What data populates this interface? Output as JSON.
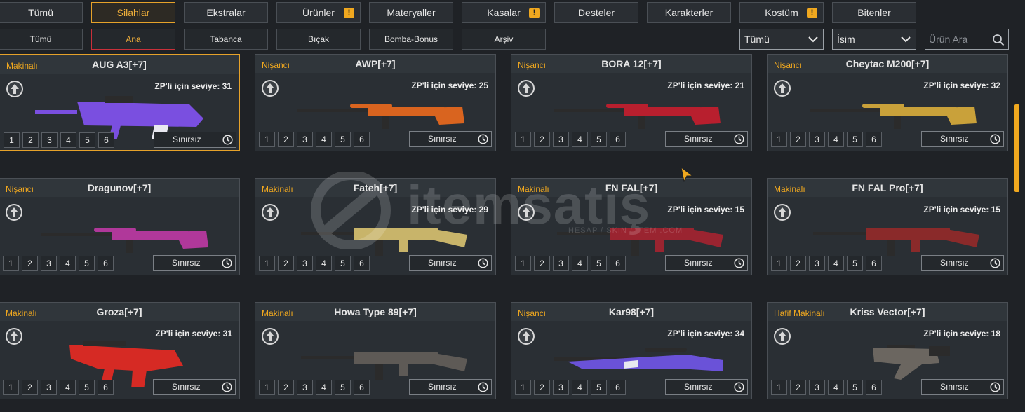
{
  "tabs": [
    {
      "label": "Tümü"
    },
    {
      "label": "Silahlar"
    },
    {
      "label": "Ekstralar"
    },
    {
      "label": "Ürünler",
      "warn": "!"
    },
    {
      "label": "Materyaller"
    },
    {
      "label": "Kasalar",
      "warn": "!"
    },
    {
      "label": "Desteler"
    },
    {
      "label": "Karakterler"
    },
    {
      "label": "Kostüm",
      "warn": "!"
    },
    {
      "label": "Bitenler"
    }
  ],
  "active_tab": "Silahlar",
  "subtabs": [
    {
      "label": "Tümü"
    },
    {
      "label": "Ana"
    },
    {
      "label": "Tabanca"
    },
    {
      "label": "Bıçak"
    },
    {
      "label": "Bomba-Bonus"
    },
    {
      "label": "Arşiv"
    }
  ],
  "active_subtab": "Ana",
  "filters": {
    "type_select": "Tümü",
    "sort_select": "İsim",
    "search_placeholder": "Ürün Ara"
  },
  "slot_numbers": [
    "1",
    "2",
    "3",
    "4",
    "5",
    "6"
  ],
  "duration_label": "Sınırsız",
  "watermark": {
    "text": "itemsatış",
    "sub": "HESAP / SKIN / ITEM .COM"
  },
  "colors": {
    "accent": "#f0a81f",
    "selected_border": "#e6a22a",
    "active_sub_border": "#c9303a"
  },
  "cards": [
    {
      "class": "Makinalı",
      "name": "AUG A3[+7]",
      "level": "ZP'li için seviye: 31",
      "gun_color": "#7a4fe0",
      "gun_shape": "aug",
      "selected": true
    },
    {
      "class": "Nişancı",
      "name": "AWP[+7]",
      "level": "ZP'li için seviye: 25",
      "gun_color": "#d9641f",
      "gun_shape": "sniper",
      "selected": false
    },
    {
      "class": "Nişancı",
      "name": "BORA 12[+7]",
      "level": "ZP'li için seviye: 21",
      "gun_color": "#b81f2e",
      "gun_shape": "sniper",
      "selected": false
    },
    {
      "class": "Nişancı",
      "name": "Cheytac M200[+7]",
      "level": "ZP'li için seviye: 32",
      "gun_color": "#c9a13a",
      "gun_shape": "sniper",
      "selected": false
    },
    {
      "class": "Nişancı",
      "name": "Dragunov[+7]",
      "level": "",
      "gun_color": "#b0389a",
      "gun_shape": "sniper",
      "selected": false
    },
    {
      "class": "Makinalı",
      "name": "Fateh[+7]",
      "level": "ZP'li için seviye: 29",
      "gun_color": "#c8b46a",
      "gun_shape": "rifle",
      "selected": false
    },
    {
      "class": "Makinalı",
      "name": "FN FAL[+7]",
      "level": "ZP'li için seviye: 15",
      "gun_color": "#9a2430",
      "gun_shape": "rifle",
      "selected": false
    },
    {
      "class": "Makinalı",
      "name": "FN FAL Pro[+7]",
      "level": "ZP'li için seviye: 15",
      "gun_color": "#8a2a2a",
      "gun_shape": "rifle",
      "selected": false
    },
    {
      "class": "Makinalı",
      "name": "Groza[+7]",
      "level": "ZP'li için seviye: 31",
      "gun_color": "#d62a24",
      "gun_shape": "groza",
      "selected": false
    },
    {
      "class": "Makinalı",
      "name": "Howa Type 89[+7]",
      "level": "",
      "gun_color": "#5e5a56",
      "gun_shape": "rifle",
      "selected": false
    },
    {
      "class": "Nişancı",
      "name": "Kar98[+7]",
      "level": "ZP'li için seviye: 34",
      "gun_color": "#6a52d8",
      "gun_shape": "kar",
      "selected": false
    },
    {
      "class": "Hafif Makinalı",
      "name": "Kriss Vector[+7]",
      "level": "ZP'li için seviye: 18",
      "gun_color": "#6b6660",
      "gun_shape": "smg",
      "selected": false
    }
  ]
}
